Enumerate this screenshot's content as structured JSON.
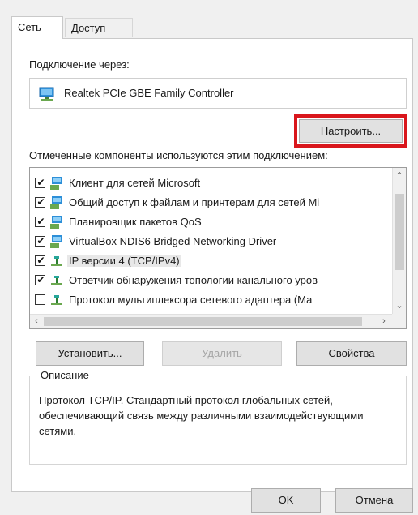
{
  "tabs": [
    {
      "label": "Сеть",
      "active": true
    },
    {
      "label": "Доступ",
      "active": false
    }
  ],
  "connect_via_label": "Подключение через:",
  "adapter": {
    "name": "Realtek PCIe GBE Family Controller",
    "icon": "network-adapter-icon"
  },
  "configure_button": "Настроить...",
  "components_label": "Отмеченные компоненты используются этим подключением:",
  "components": [
    {
      "label": "Клиент для сетей Microsoft",
      "checked": true,
      "icon": "network-client-icon"
    },
    {
      "label": "Общий доступ к файлам и принтерам для сетей Mi",
      "checked": true,
      "icon": "network-client-icon"
    },
    {
      "label": "Планировщик пакетов QoS",
      "checked": true,
      "icon": "network-client-icon"
    },
    {
      "label": "VirtualBox NDIS6 Bridged Networking Driver",
      "checked": true,
      "icon": "network-client-icon"
    },
    {
      "label": "IP версии 4 (TCP/IPv4)",
      "checked": true,
      "icon": "protocol-icon",
      "selected": true
    },
    {
      "label": "Ответчик обнаружения топологии канального уров",
      "checked": true,
      "icon": "protocol-icon"
    },
    {
      "label": "Протокол мультиплексора сетевого адаптера (Ма",
      "checked": false,
      "icon": "protocol-icon"
    }
  ],
  "buttons": {
    "install": "Установить...",
    "remove": "Удалить",
    "properties": "Свойства",
    "ok": "OK",
    "cancel": "Отмена"
  },
  "description": {
    "legend": "Описание",
    "text": "Протокол TCP/IP. Стандартный протокол глобальных сетей, обеспечивающий связь между различными взаимодействующими сетями."
  },
  "colors": {
    "highlight": "#d9161c",
    "accent": "#1e88e5"
  }
}
